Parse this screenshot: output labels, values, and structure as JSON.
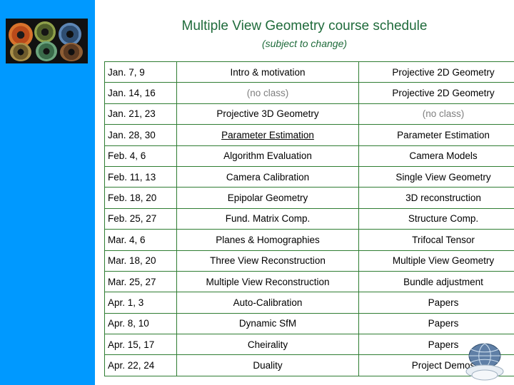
{
  "title": "Multiple View Geometry course schedule",
  "subtitle": "(subject to change)",
  "colors": {
    "band": "#0099ff",
    "title_text": "#1f6b3b",
    "table_border": "#2f7d32",
    "muted_text": "#7f7f7f"
  },
  "schedule": {
    "columns": [
      "date",
      "session_a",
      "session_b"
    ],
    "rows": [
      {
        "date": "Jan.  7, 9",
        "a": "Intro & motivation",
        "b": "Projective 2D Geometry",
        "a_style": "normal",
        "b_style": "normal"
      },
      {
        "date": "Jan. 14, 16",
        "a": "(no class)",
        "b": "Projective 2D Geometry",
        "a_style": "muted",
        "b_style": "normal"
      },
      {
        "date": "Jan. 21, 23",
        "a": "Projective 3D Geometry",
        "b": "(no class)",
        "a_style": "normal",
        "b_style": "muted"
      },
      {
        "date": "Jan. 28, 30",
        "a": "Parameter Estimation",
        "b": "Parameter Estimation",
        "a_style": "underline",
        "b_style": "normal"
      },
      {
        "date": "Feb.  4, 6",
        "a": "Algorithm Evaluation",
        "b": "Camera Models",
        "a_style": "normal",
        "b_style": "normal"
      },
      {
        "date": "Feb. 11, 13",
        "a": "Camera Calibration",
        "b": "Single View Geometry",
        "a_style": "normal",
        "b_style": "normal"
      },
      {
        "date": "Feb. 18, 20",
        "a": "Epipolar Geometry",
        "b": "3D reconstruction",
        "a_style": "normal",
        "b_style": "normal"
      },
      {
        "date": "Feb. 25, 27",
        "a": "Fund. Matrix Comp.",
        "b": "Structure Comp.",
        "a_style": "normal",
        "b_style": "normal"
      },
      {
        "date": "Mar.  4, 6",
        "a": "Planes & Homographies",
        "b": "Trifocal Tensor",
        "a_style": "normal",
        "b_style": "normal"
      },
      {
        "date": "Mar. 18, 20",
        "a": "Three View Reconstruction",
        "b": "Multiple View Geometry",
        "a_style": "normal",
        "b_style": "normal"
      },
      {
        "date": "Mar. 25, 27",
        "a": "Multiple View Reconstruction",
        "b": "Bundle adjustment",
        "a_style": "normal",
        "b_style": "normal"
      },
      {
        "date": "Apr.  1, 3",
        "a": "Auto-Calibration",
        "b": "Papers",
        "a_style": "normal",
        "b_style": "normal"
      },
      {
        "date": "Apr.  8, 10",
        "a": "Dynamic SfM",
        "b": "Papers",
        "a_style": "normal",
        "b_style": "normal"
      },
      {
        "date": "Apr. 15, 17",
        "a": "Cheirality",
        "b": "Papers",
        "a_style": "normal",
        "b_style": "normal"
      },
      {
        "date": "Apr. 22, 24",
        "a": "Duality",
        "b": "Project Demos",
        "a_style": "normal",
        "b_style": "normal"
      }
    ]
  },
  "decorations": {
    "eyes_image": "six-eyes-photo",
    "globe_logo": "globe-logo"
  }
}
